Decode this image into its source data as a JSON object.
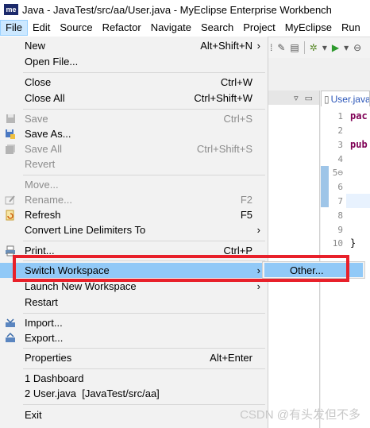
{
  "window": {
    "title": "Java - JavaTest/src/aa/User.java - MyEclipse Enterprise Workbench",
    "app_icon_text": "me"
  },
  "menubar": [
    "File",
    "Edit",
    "Source",
    "Refactor",
    "Navigate",
    "Search",
    "Project",
    "MyEclipse",
    "Run"
  ],
  "file_menu": {
    "new": {
      "label": "New",
      "accel": "Alt+Shift+N"
    },
    "open_file": {
      "label": "Open File..."
    },
    "close": {
      "label": "Close",
      "accel": "Ctrl+W"
    },
    "close_all": {
      "label": "Close All",
      "accel": "Ctrl+Shift+W"
    },
    "save": {
      "label": "Save",
      "accel": "Ctrl+S"
    },
    "save_as": {
      "label": "Save As..."
    },
    "save_all": {
      "label": "Save All",
      "accel": "Ctrl+Shift+S"
    },
    "revert": {
      "label": "Revert"
    },
    "move": {
      "label": "Move..."
    },
    "rename": {
      "label": "Rename...",
      "accel": "F2"
    },
    "refresh": {
      "label": "Refresh",
      "accel": "F5"
    },
    "convert": {
      "label": "Convert Line Delimiters To"
    },
    "print": {
      "label": "Print...",
      "accel": "Ctrl+P"
    },
    "switch_workspace": {
      "label": "Switch Workspace"
    },
    "launch_workspace": {
      "label": "Launch New Workspace"
    },
    "restart": {
      "label": "Restart"
    },
    "import": {
      "label": "Import..."
    },
    "export": {
      "label": "Export..."
    },
    "properties": {
      "label": "Properties",
      "accel": "Alt+Enter"
    },
    "recent1": {
      "label": "1 Dashboard"
    },
    "recent2": {
      "label": "2 User.java  [JavaTest/src/aa]"
    },
    "exit": {
      "label": "Exit"
    }
  },
  "submenu": {
    "other": "Other..."
  },
  "editor": {
    "tab": "User.java",
    "line_numbers": [
      "1",
      "2",
      "3",
      "4",
      "5⊖",
      "6",
      "7",
      "8",
      "9",
      "10"
    ],
    "code_pac": "pac",
    "code_pub": "pub",
    "code_brace": "}"
  },
  "watermark": "CSDN @有头发但不多",
  "colors": {
    "highlight": "#91c9f7",
    "annotation_box": "#e8202a",
    "menu_bg": "#f2f2f2"
  }
}
